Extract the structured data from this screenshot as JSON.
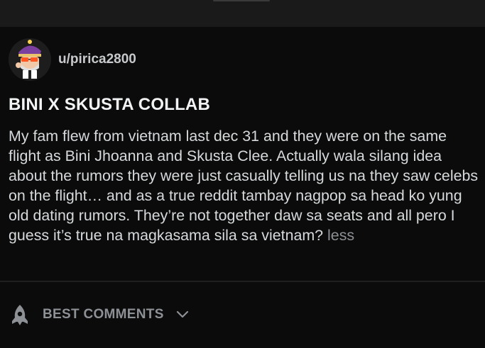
{
  "post": {
    "author": "u/pirica2800",
    "title": "BINI X SKUSTA COLLAB",
    "body": "My fam flew from vietnam last dec 31 and they were on the same flight as Bini Jhoanna and Skusta Clee. Actually wala silang idea about the rumors they were just casually telling us na they saw celebs on the flight… and as a true reddit tambay nagpop sa head ko yung old dating rumors. They’re not together daw sa seats and all pero I guess it’s true na magkasama sila sa vietnam?",
    "less_label": "less"
  },
  "comments": {
    "sort_label": "BEST COMMENTS",
    "sort_icon": "rocket-icon",
    "dropdown_icon": "chevron-down-icon"
  },
  "colors": {
    "background": "#0b0b0b",
    "top_bar": "#1a1a1a",
    "title": "#f2f3f5",
    "body_text": "#d7dadc",
    "muted": "#8d9094"
  }
}
